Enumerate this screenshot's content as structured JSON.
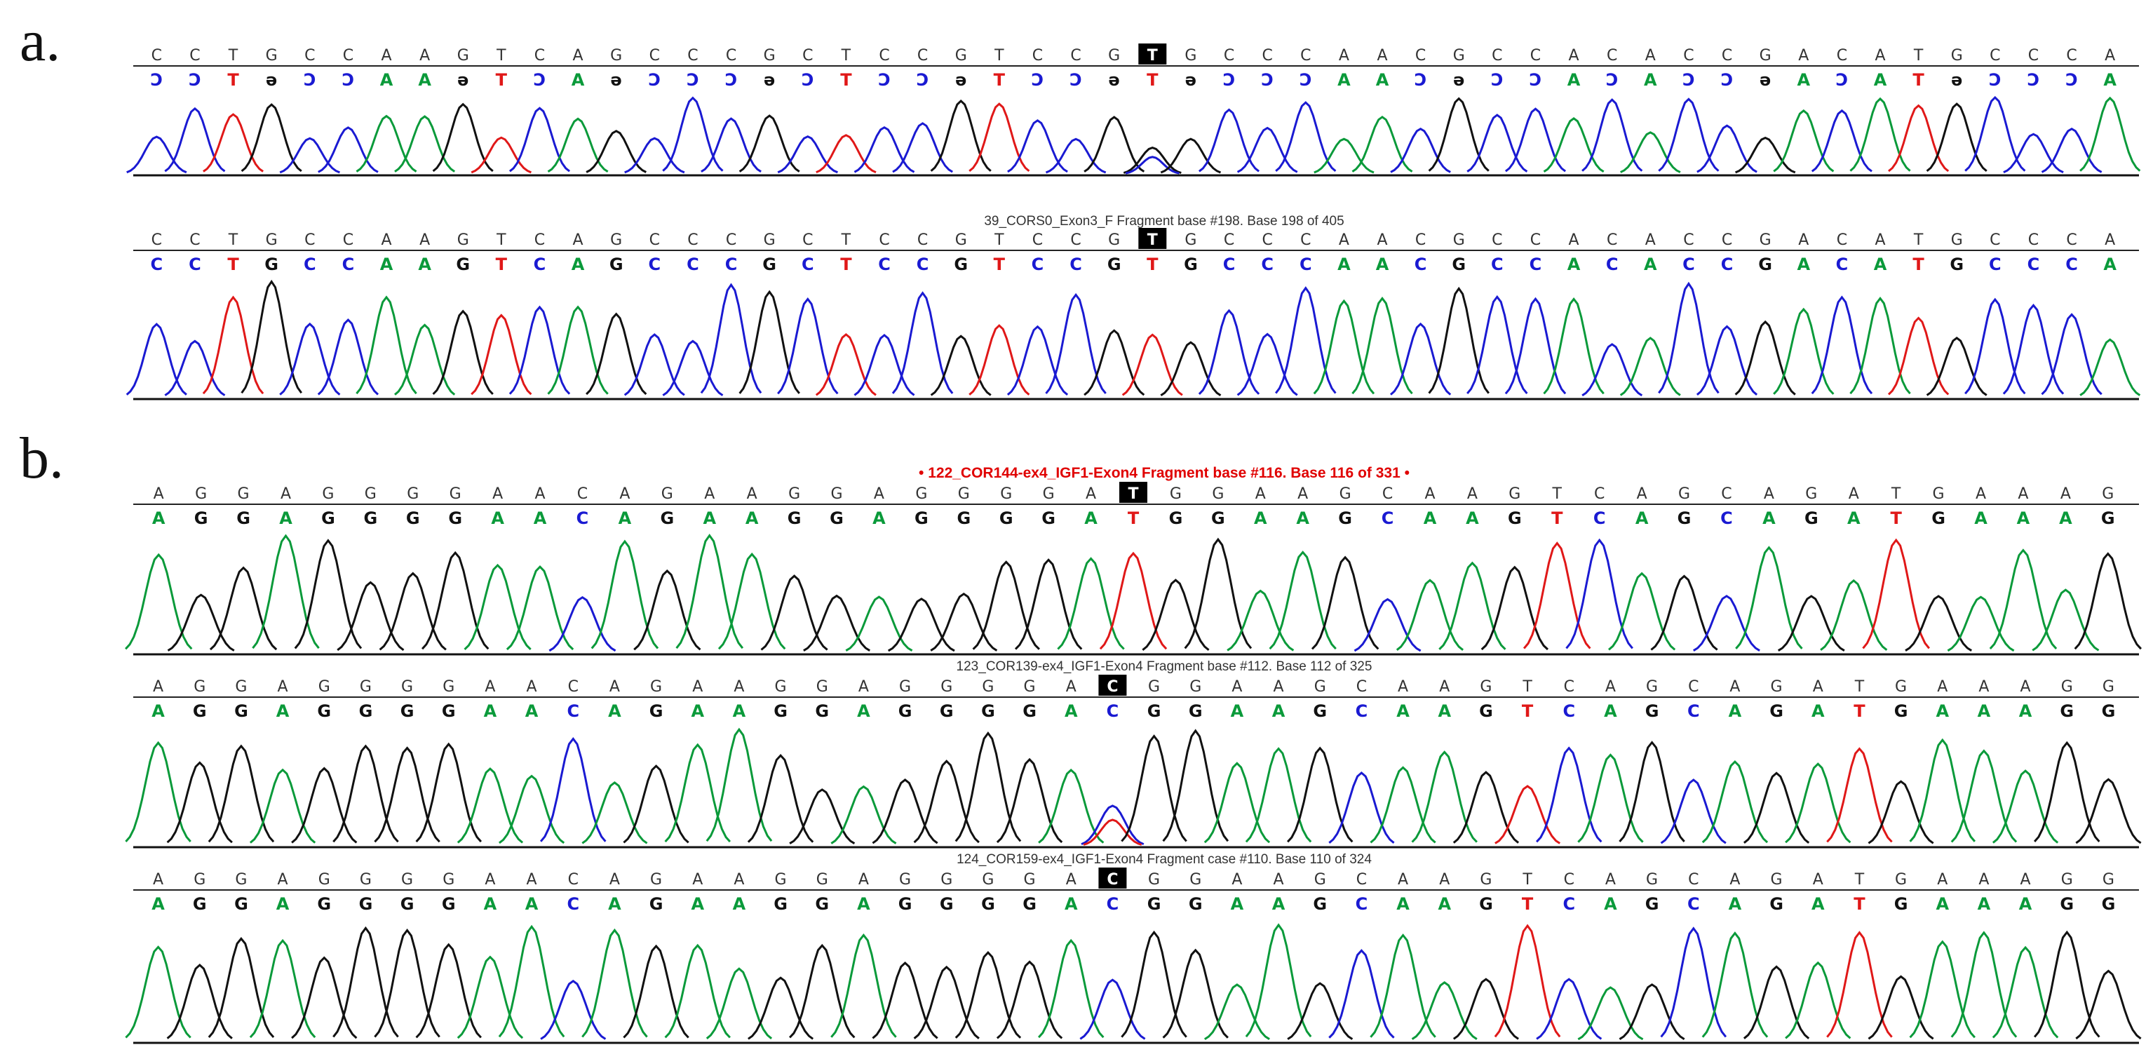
{
  "figure": {
    "panels": [
      {
        "letter": "a."
      },
      {
        "letter": "b."
      }
    ]
  },
  "colors": {
    "A": "#0a9a3a",
    "C": "#1a1ad2",
    "G": "#111111",
    "T": "#e01818",
    "highlight": "#000000",
    "red_label": "#e00000"
  },
  "chart_data": [
    {
      "type": "line",
      "panel": "a.",
      "title": "",
      "ref_sequence": "CCTGCCAAGTCAGCCCGCTCCGTCCGTGCCCAACGCCACACCGACATGCCCA",
      "called_bases": "CCTGCCAAGTCAGCCCGCTCCGTCCGTGCCCAACGCCACACCGACATGCCCA",
      "highlight_index": 26,
      "label": "",
      "call_style": "mirrored",
      "heterozygous": {
        "index": 26,
        "bases": [
          "G",
          "C"
        ]
      }
    },
    {
      "type": "line",
      "panel": "a.",
      "title": "",
      "ref_sequence": "CCTGCCAAGTCAGCCCGCTCCGTCCGTGCCCAACGCCACACCGACATGCCCA",
      "called_bases": "CCTGCCAAGTCAGCCCGCTCCGTCCGTGCCCAACGCCACACCGACATGCCCA",
      "highlight_index": 26,
      "label": "39_CORS0_Exon3_F Fragment base #198. Base 198 of 405",
      "call_style": "normal",
      "heterozygous": null
    },
    {
      "type": "line",
      "panel": "b.",
      "title": "",
      "ref_sequence": "AGGAGGGGAACAGAAGGAGGGGATGGAAGCAAGTCAGCAGATGAAAG",
      "called_bases": "AGGAGGGGAACAGAAGGAGGGGATGGAAGCAAGTCAGCAGATGAAAG",
      "highlight_index": 23,
      "label": "• 122_COR144-ex4_IGF1-Exon4 Fragment base #116. Base 116 of 331 •",
      "label_red": true,
      "call_style": "normal",
      "heterozygous": null
    },
    {
      "type": "line",
      "panel": "b.",
      "title": "",
      "ref_sequence": "AGGAGGGGAACAGAAGGAGGGGACGGAAGCAAGTCAGCAGATGAAAGG",
      "called_bases": "AGGAGGGGAACAGAAGGAGGGGACGGAAGCAAGTCAGCAGATGAAAGG",
      "highlight_index": 23,
      "label": "123_COR139-ex4_IGF1-Exon4 Fragment base #112. Base 112 of 325",
      "call_style": "normal",
      "heterozygous": {
        "index": 23,
        "bases": [
          "C",
          "T"
        ]
      }
    },
    {
      "type": "line",
      "panel": "b.",
      "title": "",
      "ref_sequence": "AGGAGGGGAACAGAAGGAGGGGACGGAAGCAAGTCAGCAGATGAAAGG",
      "called_bases": "AGGAGGGGAACAGAAGGAGGGGACGGAAGCAAGTCAGCAGATGAAAGG",
      "highlight_index": 23,
      "label": "124_COR159-ex4_IGF1-Exon4 Fragment case #110. Base 110 of 324",
      "call_style": "normal",
      "heterozygous": null
    }
  ]
}
